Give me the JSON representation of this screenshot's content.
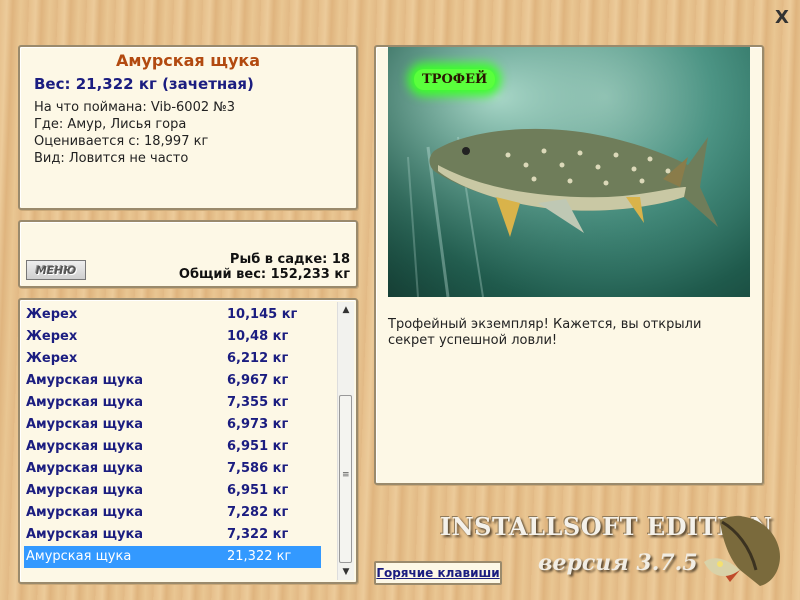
{
  "info": {
    "title": "Амурская щука",
    "weight": "Вес: 21,322 кг (зачетная)",
    "lines": [
      "На что поймана: Vib-6002 №3",
      "Где: Амур, Лисья гора",
      "Оценивается с: 18,997 кг",
      "Вид: Ловится не часто"
    ]
  },
  "stats": {
    "menu_label": "МЕНЮ",
    "fish_count": "Рыб в садке: 18",
    "total_weight": "Общий вес: 152,233 кг"
  },
  "catch_list": [
    {
      "name": "Жерех",
      "weight": "10,145 кг"
    },
    {
      "name": "Жерех",
      "weight": "10,48 кг"
    },
    {
      "name": "Жерех",
      "weight": "6,212 кг"
    },
    {
      "name": "Амурская щука",
      "weight": "6,967 кг"
    },
    {
      "name": "Амурская щука",
      "weight": "7,355 кг"
    },
    {
      "name": "Амурская щука",
      "weight": "6,973 кг"
    },
    {
      "name": "Амурская щука",
      "weight": "6,951 кг"
    },
    {
      "name": "Амурская щука",
      "weight": "7,586 кг"
    },
    {
      "name": "Амурская щука",
      "weight": "6,951 кг"
    },
    {
      "name": "Амурская щука",
      "weight": "7,282 кг"
    },
    {
      "name": "Амурская щука",
      "weight": "7,322 кг"
    },
    {
      "name": "Амурская щука",
      "weight": "21,322 кг",
      "selected": true
    }
  ],
  "photo": {
    "badge": "ТРОФЕЙ"
  },
  "description": "Трофейный экземпляр! Кажется, вы открыли секрет успешной ловли!",
  "hotkeys_label": "Горячие клавиши",
  "brand": {
    "edition": "INSTALLSOFT EDITION",
    "version": "версия 3.7.5"
  },
  "close_label": "X"
}
